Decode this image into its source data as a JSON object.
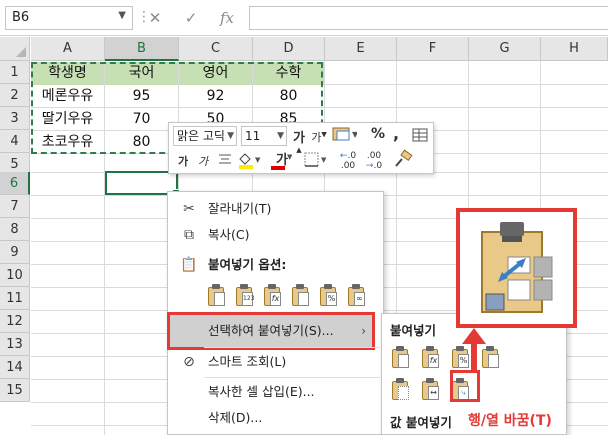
{
  "formula_bar": {
    "name_box": "B6",
    "cancel_icon": "✕",
    "enter_icon": "✓",
    "fx_label": "fx",
    "formula_value": ""
  },
  "grid": {
    "columns": [
      "A",
      "B",
      "C",
      "D",
      "E",
      "F",
      "G",
      "H"
    ],
    "rows": [
      "1",
      "2",
      "3",
      "4",
      "5",
      "6",
      "7",
      "8",
      "9",
      "10",
      "11",
      "12",
      "13",
      "14",
      "15"
    ],
    "selected_cell": "B6",
    "table": {
      "headers": [
        "학생명",
        "국어",
        "영어",
        "수학"
      ],
      "rows": [
        [
          "메론우유",
          "95",
          "92",
          "80"
        ],
        [
          "딸기우유",
          "70",
          "50",
          "85"
        ],
        [
          "초코우유",
          "80",
          "",
          ""
        ]
      ]
    }
  },
  "mini_toolbar": {
    "font_name": "맑은 고딕",
    "font_size": "11",
    "grow_font": "가",
    "shrink_font": "가",
    "percent": "%",
    "comma": ",",
    "bold": "가",
    "italic": "가",
    "font_color_glyph": "가",
    "decrease_decimal": ".00",
    "increase_decimal": ".0"
  },
  "context_menu": {
    "cut": "잘라내기(T)",
    "copy": "복사(C)",
    "paste_options": "붙여넣기 옵션:",
    "paste_special": "선택하여 붙여넣기(S)...",
    "smart_lookup": "스마트 조회(L)",
    "insert_copied": "복사한 셀 삽입(E)...",
    "delete": "삭제(D)...",
    "submenu_arrow": "›"
  },
  "paste_icons": [
    "",
    "123",
    "fx",
    "",
    "%",
    "∞"
  ],
  "submenu": {
    "paste_title": "붙여넣기",
    "values_title": "값 붙여넣기"
  },
  "callout": {
    "label": "행/열 바꿈(T)"
  },
  "colors": {
    "accent_green": "#217346",
    "header_fill": "#c6e0b4",
    "highlight_red": "#e53935"
  }
}
